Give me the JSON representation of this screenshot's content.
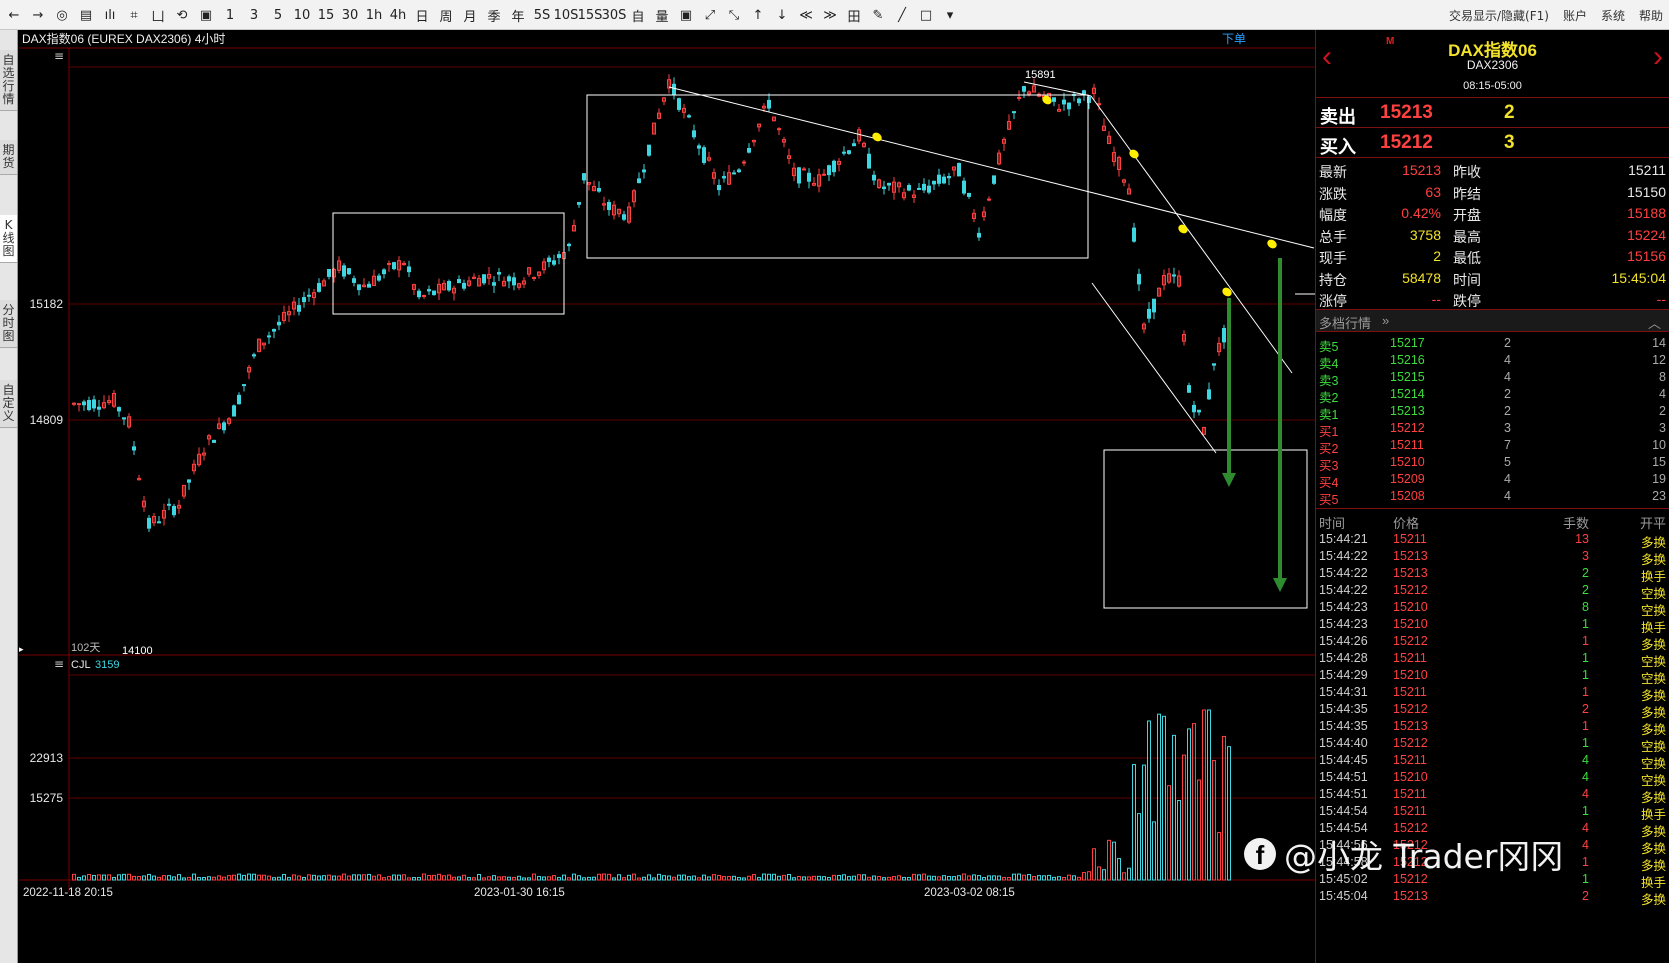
{
  "toolbar": {
    "tools": [
      "←",
      "→",
      "◎",
      "▤",
      "ılı",
      "⌗",
      "凵",
      "⟲",
      "▣",
      "1",
      "3",
      "5",
      "10",
      "15",
      "30",
      "1h",
      "4h",
      "日",
      "周",
      "月",
      "季",
      "年",
      "5S",
      "10S",
      "15S",
      "30S",
      "自",
      "量",
      "▣",
      "⤢",
      "⤡",
      "↑",
      "↓",
      "≪",
      "≫",
      "田",
      "✎",
      "╱",
      "□",
      "▾"
    ],
    "menus": [
      "交易显示/隐藏(F1)",
      "账户",
      "系统",
      "帮助"
    ]
  },
  "left_tabs": [
    {
      "label": "自选行情",
      "active": false
    },
    {
      "label": "期货",
      "active": false
    },
    {
      "label": "K线图",
      "active": true
    },
    {
      "label": "分时图",
      "active": false
    },
    {
      "label": "自定义",
      "active": false
    }
  ],
  "chart": {
    "title": "DAX指数06 (EUREX DAX2306) 4小时",
    "order_button": "下单",
    "price_labels": [
      "15182",
      "14809"
    ],
    "high_label": "15891",
    "low_label": "14100",
    "days_label": "102天",
    "volume_title": "CJL",
    "volume_value": "3159",
    "volume_labels": [
      "22913",
      "15275"
    ],
    "date_labels": [
      "2022-11-18 20:15",
      "2023-01-30 16:15",
      "2023-03-02 08:15"
    ],
    "colors": {
      "up": "#ff4040",
      "down": "#3ed6e0",
      "grid": "#7a0000",
      "annotation": "#ffee00",
      "arrow": "#2e8b2e"
    }
  },
  "panel": {
    "name": "DAX指数06",
    "badge": "M",
    "code": "DAX2306",
    "hours": "08:15-05:00",
    "sell": {
      "label": "卖出",
      "price": "15213",
      "volume": "2"
    },
    "buy": {
      "label": "买入",
      "price": "15212",
      "volume": "3"
    },
    "stats": [
      {
        "l1": "最新",
        "v1": "15213",
        "l2": "昨收",
        "v2": "15211",
        "c1": "#ff4040",
        "c2": "#e8e8e8"
      },
      {
        "l1": "涨跌",
        "v1": "63",
        "l2": "昨结",
        "v2": "15150",
        "c1": "#ff4040",
        "c2": "#e8e8e8"
      },
      {
        "l1": "幅度",
        "v1": "0.42%",
        "l2": "开盘",
        "v2": "15188",
        "c1": "#ff4040",
        "c2": "#ff4040"
      },
      {
        "l1": "总手",
        "v1": "3758",
        "l2": "最高",
        "v2": "15224",
        "c1": "#f2e22a",
        "c2": "#ff4040"
      },
      {
        "l1": "现手",
        "v1": "2",
        "l2": "最低",
        "v2": "15156",
        "c1": "#f2e22a",
        "c2": "#ff4040"
      },
      {
        "l1": "持仓",
        "v1": "58478",
        "l2": "时间",
        "v2": "15:45:04",
        "c1": "#f2e22a",
        "c2": "#f2e22a"
      },
      {
        "l1": "涨停",
        "v1": "--",
        "l2": "跌停",
        "v2": "--",
        "c1": "#ff4040",
        "c2": "#ff4040"
      }
    ],
    "depth_title": "多档行情",
    "asks": [
      {
        "label": "卖5",
        "price": "15217",
        "qty": "2",
        "cum": "14"
      },
      {
        "label": "卖4",
        "price": "15216",
        "qty": "4",
        "cum": "12"
      },
      {
        "label": "卖3",
        "price": "15215",
        "qty": "4",
        "cum": "8"
      },
      {
        "label": "卖2",
        "price": "15214",
        "qty": "2",
        "cum": "4"
      },
      {
        "label": "卖1",
        "price": "15213",
        "qty": "2",
        "cum": "2"
      }
    ],
    "bids": [
      {
        "label": "买1",
        "price": "15212",
        "qty": "3",
        "cum": "3"
      },
      {
        "label": "买2",
        "price": "15211",
        "qty": "7",
        "cum": "10"
      },
      {
        "label": "买3",
        "price": "15210",
        "qty": "5",
        "cum": "15"
      },
      {
        "label": "买4",
        "price": "15209",
        "qty": "4",
        "cum": "19"
      },
      {
        "label": "买5",
        "price": "15208",
        "qty": "4",
        "cum": "23"
      }
    ],
    "tick_headers": [
      "时间",
      "价格",
      "手数",
      "开平"
    ],
    "ticks": [
      {
        "t": "15:44:21",
        "p": "15211",
        "q": "13",
        "k": "多换",
        "qc": "#ff4040"
      },
      {
        "t": "15:44:22",
        "p": "15213",
        "q": "3",
        "k": "多换",
        "qc": "#ff4040"
      },
      {
        "t": "15:44:22",
        "p": "15213",
        "q": "2",
        "k": "换手",
        "qc": "#3ddc3d"
      },
      {
        "t": "15:44:22",
        "p": "15212",
        "q": "2",
        "k": "空换",
        "qc": "#3ddc3d"
      },
      {
        "t": "15:44:23",
        "p": "15210",
        "q": "8",
        "k": "空换",
        "qc": "#3ddc3d"
      },
      {
        "t": "15:44:23",
        "p": "15210",
        "q": "1",
        "k": "换手",
        "qc": "#3ddc3d"
      },
      {
        "t": "15:44:26",
        "p": "15212",
        "q": "1",
        "k": "多换",
        "qc": "#ff4040"
      },
      {
        "t": "15:44:28",
        "p": "15211",
        "q": "1",
        "k": "空换",
        "qc": "#3ddc3d"
      },
      {
        "t": "15:44:29",
        "p": "15210",
        "q": "1",
        "k": "空换",
        "qc": "#3ddc3d"
      },
      {
        "t": "15:44:31",
        "p": "15211",
        "q": "1",
        "k": "多换",
        "qc": "#ff4040"
      },
      {
        "t": "15:44:35",
        "p": "15212",
        "q": "2",
        "k": "多换",
        "qc": "#ff4040"
      },
      {
        "t": "15:44:35",
        "p": "15213",
        "q": "1",
        "k": "多换",
        "qc": "#ff4040"
      },
      {
        "t": "15:44:40",
        "p": "15212",
        "q": "1",
        "k": "空换",
        "qc": "#3ddc3d"
      },
      {
        "t": "15:44:45",
        "p": "15211",
        "q": "4",
        "k": "空换",
        "qc": "#3ddc3d"
      },
      {
        "t": "15:44:51",
        "p": "15210",
        "q": "4",
        "k": "空换",
        "qc": "#3ddc3d"
      },
      {
        "t": "15:44:51",
        "p": "15211",
        "q": "4",
        "k": "多换",
        "qc": "#ff4040"
      },
      {
        "t": "15:44:54",
        "p": "15211",
        "q": "1",
        "k": "换手",
        "qc": "#3ddc3d"
      },
      {
        "t": "15:44:54",
        "p": "15212",
        "q": "4",
        "k": "多换",
        "qc": "#ff4040"
      },
      {
        "t": "15:44:56",
        "p": "15212",
        "q": "4",
        "k": "多换",
        "qc": "#ff4040"
      },
      {
        "t": "15:44:58",
        "p": "15212",
        "q": "1",
        "k": "多换",
        "qc": "#ff4040"
      },
      {
        "t": "15:45:02",
        "p": "15212",
        "q": "1",
        "k": "换手",
        "qc": "#3ddc3d"
      },
      {
        "t": "15:45:04",
        "p": "15213",
        "q": "2",
        "k": "多换",
        "qc": "#ff4040"
      }
    ]
  },
  "watermark": {
    "logo": "f",
    "text": "@小龙 Trader冈冈"
  }
}
